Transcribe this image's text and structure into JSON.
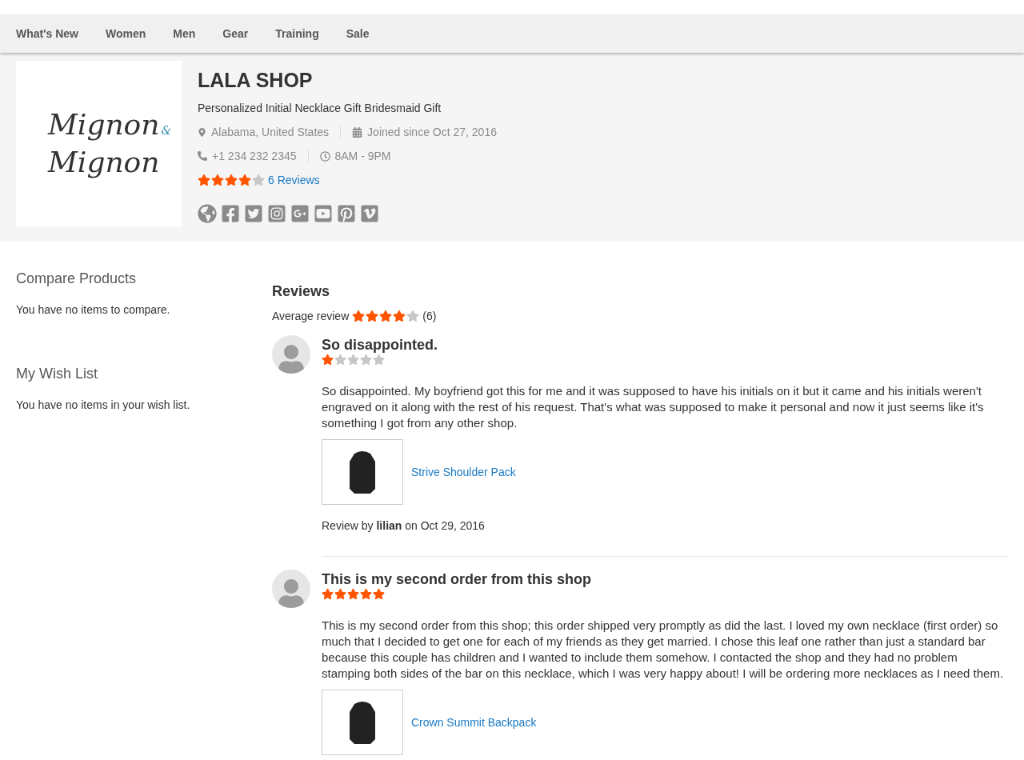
{
  "nav": [
    {
      "label": "What's New"
    },
    {
      "label": "Women"
    },
    {
      "label": "Men"
    },
    {
      "label": "Gear"
    },
    {
      "label": "Training"
    },
    {
      "label": "Sale"
    }
  ],
  "shop": {
    "logo": {
      "top": "Mignon",
      "ampersand": "&",
      "bottom": "Mignon"
    },
    "name": "LALA SHOP",
    "tagline": "Personalized Initial Necklace Gift Bridesmaid Gift",
    "location": "Alabama, United States",
    "joined": "Joined since Oct 27, 2016",
    "phone": "+1 234 232 2345",
    "hours": "8AM - 9PM",
    "stars": 4,
    "reviews_link": "6 Reviews",
    "social": [
      {
        "kind": "website"
      },
      {
        "kind": "facebook"
      },
      {
        "kind": "twitter"
      },
      {
        "kind": "instagram"
      },
      {
        "kind": "googleplus"
      },
      {
        "kind": "youtube"
      },
      {
        "kind": "pinterest"
      },
      {
        "kind": "vimeo"
      }
    ]
  },
  "sidebar": [
    {
      "title": "Compare Products",
      "text": "You have no items to compare."
    },
    {
      "title": "My Wish List",
      "text": "You have no items in your wish list."
    }
  ],
  "reviews": {
    "title": "Reviews",
    "average_label": "Average review",
    "stars": 4,
    "count": "(6)",
    "items": [
      {
        "title": "So disappointed.",
        "stars": 1,
        "body": "So disappointed. My boyfriend got this for me and it was supposed to have his initials on it but it came and his initials weren't engraved on it along with the rest of his request. That's what was supposed to make it personal and now it just seems like it's something I got from any other shop.",
        "product": "Strive Shoulder Pack",
        "byline": "Review by **lilian** on Oct 29, 2016"
      },
      {
        "title": "This is my second order from this shop",
        "stars": 5,
        "body": "This is my second order from this shop; this order shipped very promptly as did the last. I loved my own necklace (first order) so much that I decided to get one for each of my friends as they get married. I chose this leaf one rather than just a standard bar because this couple has children and I wanted to include them somehow. I contacted the shop and they had no problem stamping both sides of the bar on this necklace, which I was very happy about! I will be ordering more necklaces as I need them.",
        "product": "Crown Summit Backpack"
      }
    ]
  }
}
